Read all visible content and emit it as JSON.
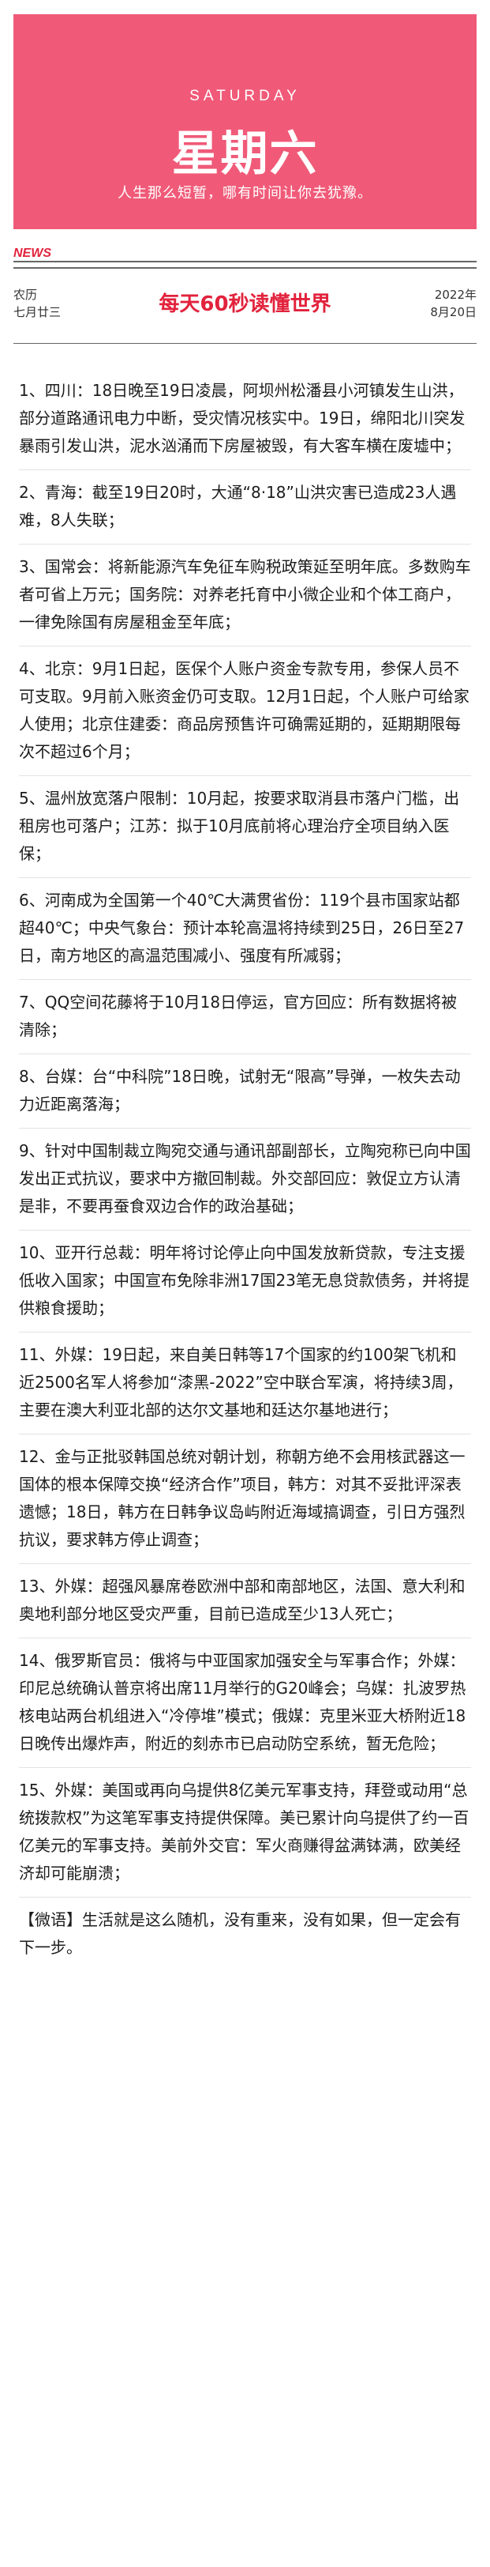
{
  "header": {
    "weekday_en": "SATURDAY",
    "weekday_cn": "星期六",
    "slogan": "人生那么短暂，哪有时间让你去犹豫。"
  },
  "masthead": {
    "tag": "NEWS",
    "lunar_label": "农历",
    "lunar_date": "七月廿三",
    "title": "每天60秒读懂世界",
    "year": "2022年",
    "date": "8月20日"
  },
  "news": [
    "1、四川：18日晚至19日凌晨，阿坝州松潘县小河镇发生山洪，部分道路通讯电力中断，受灾情况核实中。19日，绵阳北川突发暴雨引发山洪，泥水汹涌而下房屋被毁，有大客车横在废墟中；",
    "2、青海：截至19日20时，大通“8·18”山洪灾害已造成23人遇难，8人失联；",
    "3、国常会：将新能源汽车免征车购税政策延至明年底。多数购车者可省上万元；国务院：对养老托育中小微企业和个体工商户，一律免除国有房屋租金至年底；",
    "4、北京：9月1日起，医保个人账户资金专款专用，参保人员不可支取。9月前入账资金仍可支取。12月1日起，个人账户可给家人使用；北京住建委：商品房预售许可确需延期的，延期期限每次不超过6个月；",
    "5、温州放宽落户限制：10月起，按要求取消县市落户门槛，出租房也可落户；江苏：拟于10月底前将心理治疗全项目纳入医保；",
    "6、河南成为全国第一个40℃大满贯省份：119个县市国家站都超40℃；中央气象台：预计本轮高温将持续到25日，26日至27日，南方地区的高温范围减小、强度有所减弱；",
    "7、QQ空间花藤将于10月18日停运，官方回应：所有数据将被清除；",
    "8、台媒：台“中科院”18日晚，试射无“限高”导弹，一枚失去动力近距离落海；",
    "9、针对中国制裁立陶宛交通与通讯部副部长，立陶宛称已向中国发出正式抗议，要求中方撤回制裁。外交部回应：敦促立方认清是非，不要再蚕食双边合作的政治基础；",
    "10、亚开行总裁：明年将讨论停止向中国发放新贷款，专注支援低收入国家；中国宣布免除非洲17国23笔无息贷款债务，并将提供粮食援助；",
    "11、外媒：19日起，来自美日韩等17个国家的约100架飞机和近2500名军人将参加“漆黑-2022”空中联合军演，将持续3周，主要在澳大利亚北部的达尔文基地和廷达尔基地进行；",
    "12、金与正批驳韩国总统对朝计划，称朝方绝不会用核武器这一国体的根本保障交换“经济合作”项目，韩方：对其不妥批评深表遗憾；18日，韩方在日韩争议岛屿附近海域搞调查，引日方强烈抗议，要求韩方停止调查；",
    "13、外媒：超强风暴席卷欧洲中部和南部地区，法国、意大利和奥地利部分地区受灾严重，目前已造成至少13人死亡；",
    "14、俄罗斯官员：俄将与中亚国家加强安全与军事合作；外媒：印尼总统确认普京将出席11月举行的G20峰会；乌媒：扎波罗热核电站两台机组进入“冷停堆”模式；俄媒：克里米亚大桥附近18日晚传出爆炸声，附近的刻赤市已启动防空系统，暂无危险；",
    "15、外媒：美国或再向乌提供8亿美元军事支持，拜登或动用“总统拨款权”为这笔军事支持提供保障。美已累计向乌提供了约一百亿美元的军事支持。美前外交官：军火商赚得盆满钵满，欧美经济却可能崩溃；",
    "【微语】生活就是这么随机，没有重来，没有如果，但一定会有下一步。"
  ]
}
